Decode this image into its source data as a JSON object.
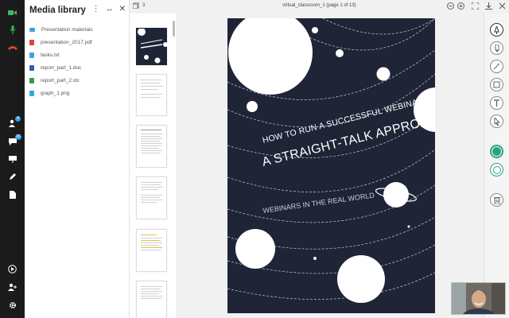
{
  "rail": {
    "items": [
      {
        "icon": "video-camera-icon",
        "color": "#3dbb5f"
      },
      {
        "icon": "microphone-icon",
        "color": "#3dbb5f"
      },
      {
        "icon": "hang-up-icon",
        "color": "#e0453a"
      },
      {
        "icon": "participants-icon",
        "badge": "4"
      },
      {
        "icon": "chat-icon",
        "badge": "26"
      },
      {
        "icon": "presentation-icon"
      },
      {
        "icon": "pen-icon"
      },
      {
        "icon": "document-icon"
      },
      {
        "icon": "play-icon"
      },
      {
        "icon": "add-user-icon"
      },
      {
        "icon": "settings-icon"
      }
    ]
  },
  "media": {
    "title": "Media library",
    "files": [
      {
        "name": "Presentation materials",
        "icon": "folder-icon",
        "color": "#3aa3e3"
      },
      {
        "name": "presentation_2017.pdf",
        "icon": "pdf-file-icon",
        "color": "#e0453a"
      },
      {
        "name": "tasks.txt",
        "icon": "text-file-icon",
        "color": "#3aa3e3"
      },
      {
        "name": "report_part_1.doc",
        "icon": "doc-file-icon",
        "color": "#2b62b8"
      },
      {
        "name": "report_part_2.xlc",
        "icon": "spreadsheet-file-icon",
        "color": "#2e9b48"
      },
      {
        "name": "graph_1.png",
        "icon": "image-file-icon",
        "color": "#3aa3e3"
      }
    ]
  },
  "topbar": {
    "page_count": "3",
    "doc_title": "virtual_classroom_1 (page 1 of 13)"
  },
  "slide": {
    "headline_1": "HOW TO RUN A SUCCESSFUL WEBINAR:",
    "headline_2": "A STRAIGHT-TALK APPROACH",
    "subtitle": "WEBINARS IN THE REAL WORLD"
  },
  "tools": [
    "pen-tool-icon",
    "pencil-tool-icon",
    "line-tool-icon",
    "rectangle-tool-icon",
    "text-tool-icon",
    "pointer-tool-icon",
    "color-fill-icon",
    "color-stroke-icon",
    "trash-icon"
  ],
  "colors": {
    "accent": "#2aa37f",
    "slide_bg": "#1f2437"
  }
}
